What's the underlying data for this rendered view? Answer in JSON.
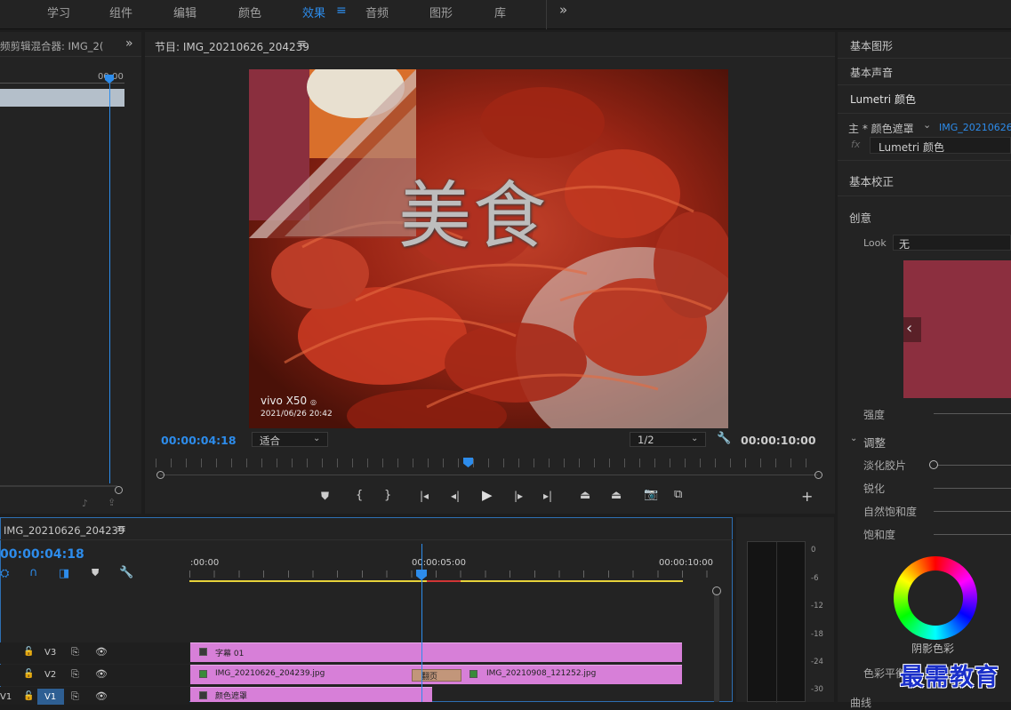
{
  "workspaces": [
    "学习",
    "组件",
    "编辑",
    "颜色",
    "效果",
    "音频",
    "图形",
    "库"
  ],
  "workspace_active": "效果",
  "audio_mixer": {
    "title": "频剪辑混合器: IMG_2(",
    "time": "00:00"
  },
  "program": {
    "title": "节目: IMG_20210626_204239",
    "timecode_current": "00:00:04:18",
    "fit": "适合",
    "resolution": "1/2",
    "timecode_duration": "00:00:10:00",
    "overlay_title": "美食",
    "watermark_brand": "vivo X50",
    "watermark_date": "2021/06/26 20:42"
  },
  "timeline": {
    "title": "IMG_20210626_204239",
    "timecode": "00:00:04:18",
    "ruler": [
      ":00:00",
      "00:00:05:00",
      "00:00:10:00"
    ],
    "tracks": [
      {
        "name": "V3",
        "clips": [
          {
            "label": "字幕 01"
          }
        ]
      },
      {
        "name": "V2",
        "clips": [
          {
            "label": "IMG_20210626_204239.jpg"
          },
          {
            "label": "翻页"
          },
          {
            "label": "IMG_20210908_121252.jpg"
          }
        ]
      },
      {
        "name": "V1",
        "src": "V1",
        "clips": [
          {
            "label": "颜色遮罩"
          }
        ]
      }
    ]
  },
  "meter": {
    "labels": [
      "0",
      "-6",
      "-12",
      "-18",
      "-24",
      "-30"
    ]
  },
  "lumetri": {
    "tabs": [
      "基本图形",
      "基本声音",
      "Lumetri 颜色"
    ],
    "master": "主 * 颜色遮罩",
    "clip_link": "IMG_20210626_",
    "fx_name": "Lumetri 颜色",
    "sections": {
      "basic": "基本校正",
      "creative": "创意"
    },
    "look_label": "Look",
    "look_value": "无",
    "intensity": "强度",
    "adjust": "调整",
    "adjust_items": [
      "淡化胶片",
      "锐化",
      "自然饱和度",
      "饱和度"
    ],
    "wheel_label": "阴影色彩",
    "balance_label": "色彩平衡",
    "curves_label": "曲线",
    "swatch_color": "#8c2f3f"
  },
  "brand_watermark": "最需教育"
}
